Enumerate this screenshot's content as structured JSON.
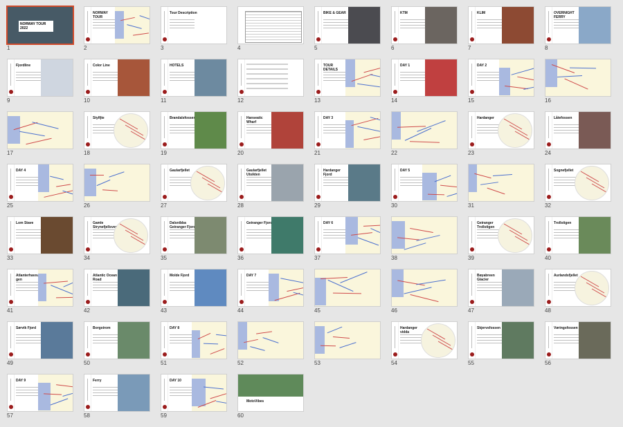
{
  "window": {
    "title": ""
  },
  "slides": [
    {
      "num": "1",
      "title": "NORWAY TOUR\n2022",
      "type": "cover",
      "photo": "#475a66"
    },
    {
      "num": "2",
      "title": "NORWAY\nTOUR",
      "type": "map-half"
    },
    {
      "num": "3",
      "title": "Tour Description",
      "type": "text"
    },
    {
      "num": "4",
      "title": "",
      "type": "table"
    },
    {
      "num": "5",
      "title": "BIKE & GEAR",
      "type": "photo",
      "photo": "#4b4b50"
    },
    {
      "num": "6",
      "title": "KTM",
      "type": "photo",
      "photo": "#6b6560"
    },
    {
      "num": "7",
      "title": "KLIM",
      "type": "photo",
      "photo": "#8d4a33"
    },
    {
      "num": "8",
      "title": "OVERNIGHT\nFERRY",
      "type": "photo",
      "photo": "#8aa8c8"
    },
    {
      "num": "9",
      "title": "Fjordline",
      "type": "photo",
      "photo": "#cfd6e0"
    },
    {
      "num": "10",
      "title": "Color Line",
      "type": "photo",
      "photo": "#a7563a"
    },
    {
      "num": "11",
      "title": "HOTELS",
      "type": "photo-left",
      "photo": "#6d8aa0"
    },
    {
      "num": "12",
      "title": "",
      "type": "list"
    },
    {
      "num": "13",
      "title": "TOUR\nDETAILS",
      "type": "map-half"
    },
    {
      "num": "14",
      "title": "DAY 1",
      "type": "photo",
      "photo": "#c04040"
    },
    {
      "num": "15",
      "title": "DAY 2",
      "type": "map-half"
    },
    {
      "num": "16",
      "title": "",
      "type": "map-full"
    },
    {
      "num": "17",
      "title": "",
      "type": "map-full"
    },
    {
      "num": "18",
      "title": "Stylfjte",
      "type": "circle"
    },
    {
      "num": "19",
      "title": "Brandalsfossen",
      "type": "photo",
      "photo": "#5f8a4a"
    },
    {
      "num": "20",
      "title": "Hanseatic\nWharf",
      "type": "photo",
      "photo": "#b0433a"
    },
    {
      "num": "21",
      "title": "DAY 3",
      "type": "map-half"
    },
    {
      "num": "22",
      "title": "",
      "type": "map-full"
    },
    {
      "num": "23",
      "title": "Hardanger",
      "type": "circle"
    },
    {
      "num": "24",
      "title": "Låtefossen",
      "type": "photo",
      "photo": "#7a5a55"
    },
    {
      "num": "25",
      "title": "DAY 4",
      "type": "map-half"
    },
    {
      "num": "26",
      "title": "",
      "type": "map-full"
    },
    {
      "num": "27",
      "title": "Gaularfjellet",
      "type": "circle"
    },
    {
      "num": "28",
      "title": "Gaularfjellet\nUtsikten",
      "type": "photo",
      "photo": "#9aa4ad"
    },
    {
      "num": "29",
      "title": "Hardanger\nFjord",
      "type": "photo",
      "photo": "#5a7a88"
    },
    {
      "num": "30",
      "title": "DAY 5",
      "type": "map-half"
    },
    {
      "num": "31",
      "title": "",
      "type": "map-full"
    },
    {
      "num": "32",
      "title": "Sognefjellet",
      "type": "circle"
    },
    {
      "num": "33",
      "title": "Lom Stave",
      "type": "photo",
      "photo": "#6a4a30"
    },
    {
      "num": "34",
      "title": "Gamle\nStrynefjellsvegen",
      "type": "circle"
    },
    {
      "num": "35",
      "title": "Dalsnibba\nGeiranger Fjord",
      "type": "photo",
      "photo": "#7d8a70"
    },
    {
      "num": "36",
      "title": "Geiranger Fjord",
      "type": "photo",
      "photo": "#3f7a6a"
    },
    {
      "num": "37",
      "title": "DAY 6",
      "type": "map-half"
    },
    {
      "num": "38",
      "title": "",
      "type": "map-full"
    },
    {
      "num": "39",
      "title": "Geiranger\nTrollstigen",
      "type": "circle"
    },
    {
      "num": "40",
      "title": "Trollstigen",
      "type": "photo",
      "photo": "#6a8a5a"
    },
    {
      "num": "41",
      "title": "Atlanterhavsve\ngen",
      "type": "map-half"
    },
    {
      "num": "42",
      "title": "Atlantic Ocean\nRoad",
      "type": "photo",
      "photo": "#4a6a7a"
    },
    {
      "num": "43",
      "title": "Molde Fjord",
      "type": "photo",
      "photo": "#5f8ac0"
    },
    {
      "num": "44",
      "title": "DAY 7",
      "type": "map-half"
    },
    {
      "num": "45",
      "title": "",
      "type": "map-full"
    },
    {
      "num": "46",
      "title": "",
      "type": "map-full"
    },
    {
      "num": "47",
      "title": "Bøyabreen\nGlacier",
      "type": "photo",
      "photo": "#9aa9b8"
    },
    {
      "num": "48",
      "title": "Aurlandsfjellet",
      "type": "circle"
    },
    {
      "num": "49",
      "title": "Sørvik Fjord",
      "type": "photo-left",
      "photo": "#5a7a9a"
    },
    {
      "num": "50",
      "title": "Borgstrom",
      "type": "photo",
      "photo": "#6a8a6a"
    },
    {
      "num": "51",
      "title": "DAY 8",
      "type": "map-half"
    },
    {
      "num": "52",
      "title": "",
      "type": "map-full"
    },
    {
      "num": "53",
      "title": "",
      "type": "map-full"
    },
    {
      "num": "54",
      "title": "Hardanger\nvidda",
      "type": "circle"
    },
    {
      "num": "55",
      "title": "Skjervsfossen",
      "type": "photo",
      "photo": "#5f7a60"
    },
    {
      "num": "56",
      "title": "Vøringsfossen",
      "type": "photo",
      "photo": "#6a6a5a"
    },
    {
      "num": "57",
      "title": "DAY 9",
      "type": "map-half"
    },
    {
      "num": "58",
      "title": "Ferry",
      "type": "photo",
      "photo": "#7a9ab8"
    },
    {
      "num": "59",
      "title": "DAY 10",
      "type": "map-half"
    },
    {
      "num": "60",
      "title": "MotoVibes",
      "type": "end",
      "photo": "#5f8a5a"
    }
  ]
}
